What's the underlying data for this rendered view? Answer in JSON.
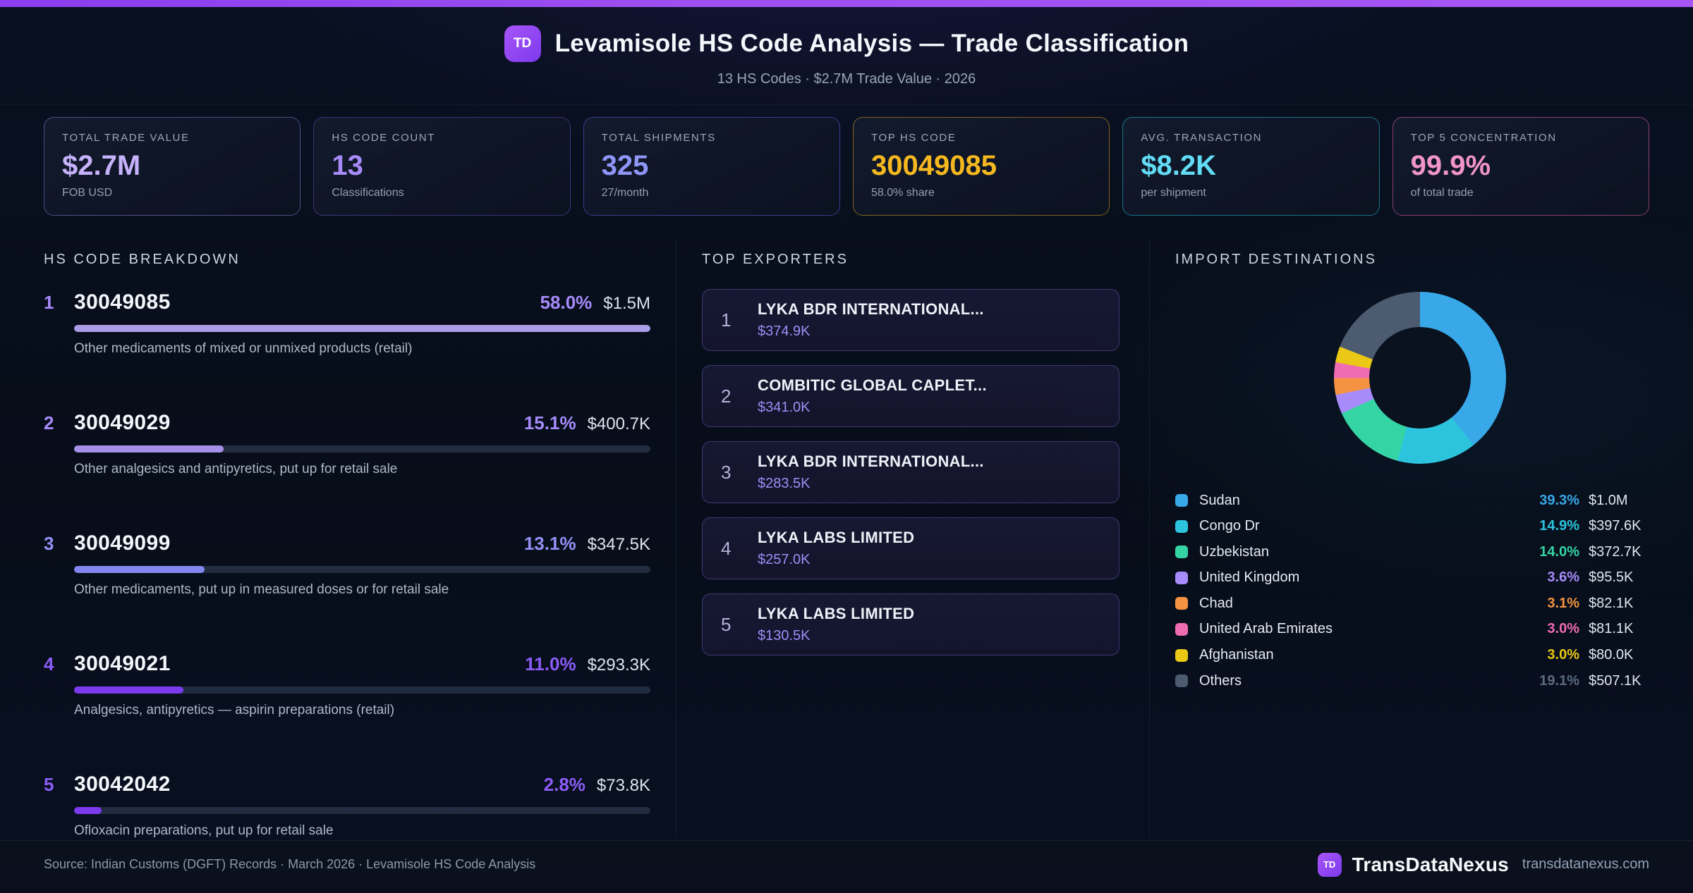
{
  "header": {
    "badge": "TD",
    "title": "Levamisole HS Code Analysis — Trade Classification",
    "subtitle": "13 HS Codes · $2.7M Trade Value · 2026"
  },
  "stats": [
    {
      "label": "TOTAL TRADE VALUE",
      "value": "$2.7M",
      "sub": "FOB USD",
      "value_color": "#c6b2fb",
      "border_color": "rgba(167,139,250,0.45)"
    },
    {
      "label": "HS CODE COUNT",
      "value": "13",
      "sub": "Classifications",
      "value_color": "#a78bfa",
      "border_color": "rgba(139,92,246,0.40)"
    },
    {
      "label": "TOTAL SHIPMENTS",
      "value": "325",
      "sub": "27/month",
      "value_color": "#8f96f8",
      "border_color": "rgba(99,102,241,0.50)"
    },
    {
      "label": "TOP HS CODE",
      "value": "30049085",
      "sub": "58.0% share",
      "value_color": "#f5b81f",
      "border_color": "rgba(202,153,23,0.60)"
    },
    {
      "label": "AVG. TRANSACTION",
      "value": "$8.2K",
      "sub": "per shipment",
      "value_color": "#62dcf5",
      "border_color": "rgba(34,211,238,0.50)"
    },
    {
      "label": "TOP 5 CONCENTRATION",
      "value": "99.9%",
      "sub": "of total trade",
      "value_color": "#f194ca",
      "border_color": "rgba(236,100,171,0.55)"
    }
  ],
  "sections": {
    "breakdown": "HS CODE BREAKDOWN",
    "exporters": "TOP EXPORTERS",
    "destinations": "IMPORT DESTINATIONS"
  },
  "breakdown": [
    {
      "rank": "1",
      "code": "30049085",
      "pct": "58.0%",
      "pct_num": 58.0,
      "value": "$1.5M",
      "desc": "Other medicaments of mixed or unmixed products (retail)",
      "accent": "#a78bfa",
      "bar_color": "#ab9ce8"
    },
    {
      "rank": "2",
      "code": "30049029",
      "pct": "15.1%",
      "pct_num": 15.1,
      "value": "$400.7K",
      "desc": "Other analgesics and antipyretics, put up for retail sale",
      "accent": "#a78bfa",
      "bar_color": "#a490e8"
    },
    {
      "rank": "3",
      "code": "30049099",
      "pct": "13.1%",
      "pct_num": 13.1,
      "value": "$347.5K",
      "desc": "Other medicaments, put up in measured doses or for retail sale",
      "accent": "#9390f5",
      "bar_color": "#8287ef"
    },
    {
      "rank": "4",
      "code": "30049021",
      "pct": "11.0%",
      "pct_num": 11.0,
      "value": "$293.3K",
      "desc": "Analgesics, antipyretics — aspirin preparations (retail)",
      "accent": "#8b5cf6",
      "bar_color": "#7c3aed"
    },
    {
      "rank": "5",
      "code": "30042042",
      "pct": "2.8%",
      "pct_num": 2.8,
      "value": "$73.8K",
      "desc": "Ofloxacin preparations, put up for retail sale",
      "accent": "#8b5cf6",
      "bar_color": "#7c3aed"
    }
  ],
  "breakdown_max_pct": 58.0,
  "exporters": [
    {
      "rank": "1",
      "name": "LYKA BDR INTERNATIONAL...",
      "value": "$374.9K"
    },
    {
      "rank": "2",
      "name": "COMBITIC GLOBAL CAPLET...",
      "value": "$341.0K"
    },
    {
      "rank": "3",
      "name": "LYKA BDR INTERNATIONAL...",
      "value": "$283.5K"
    },
    {
      "rank": "4",
      "name": "LYKA LABS LIMITED",
      "value": "$257.0K"
    },
    {
      "rank": "5",
      "name": "LYKA LABS LIMITED",
      "value": "$130.5K"
    }
  ],
  "chart_data": {
    "type": "pie",
    "subtype": "donut",
    "title": "IMPORT DESTINATIONS",
    "legend_position": "below",
    "start_angle_deg": 0,
    "inner_radius_ratio": 0.59,
    "segments": [
      {
        "label": "Sudan",
        "pct": 39.3,
        "pct_label": "39.3%",
        "value": "$1.0M",
        "color": "#38a8e8",
        "pct_text_color": "#38a8e8"
      },
      {
        "label": "Congo Dr",
        "pct": 14.9,
        "pct_label": "14.9%",
        "value": "$397.6K",
        "color": "#2cc4dd",
        "pct_text_color": "#2cc4dd"
      },
      {
        "label": "Uzbekistan",
        "pct": 14.0,
        "pct_label": "14.0%",
        "value": "$372.7K",
        "color": "#35d4a5",
        "pct_text_color": "#35d4a5"
      },
      {
        "label": "United Kingdom",
        "pct": 3.6,
        "pct_label": "3.6%",
        "value": "$95.5K",
        "color": "#a78bfa",
        "pct_text_color": "#a78bfa"
      },
      {
        "label": "Chad",
        "pct": 3.1,
        "pct_label": "3.1%",
        "value": "$82.1K",
        "color": "#f59342",
        "pct_text_color": "#f59342"
      },
      {
        "label": "United Arab Emirates",
        "pct": 3.0,
        "pct_label": "3.0%",
        "value": "$81.1K",
        "color": "#ef6cb2",
        "pct_text_color": "#ef6cb2"
      },
      {
        "label": "Afghanistan",
        "pct": 3.0,
        "pct_label": "3.0%",
        "value": "$80.0K",
        "color": "#eac815",
        "pct_text_color": "#eac815"
      },
      {
        "label": "Others",
        "pct": 19.1,
        "pct_label": "19.1%",
        "value": "$507.1K",
        "color": "#4c5b70",
        "pct_text_color": "#5c6b80"
      }
    ]
  },
  "footer": {
    "source": "Source: Indian Customs (DGFT) Records · March 2026 · Levamisole HS Code Analysis",
    "badge": "TD",
    "brand": "TransDataNexus",
    "domain": "transdatanexus.com"
  }
}
